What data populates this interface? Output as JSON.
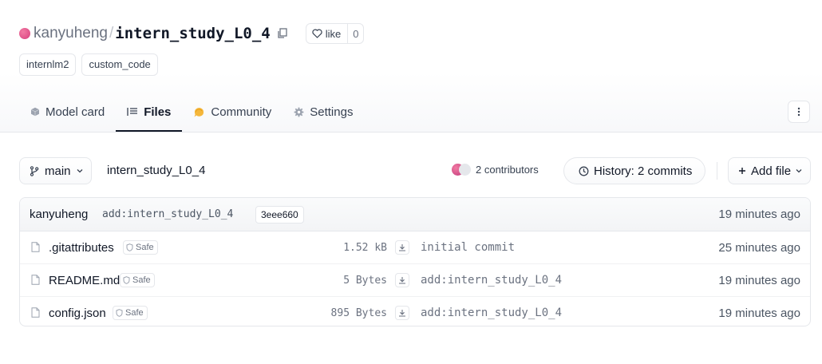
{
  "header": {
    "owner": "kanyuheng",
    "separator": "/",
    "repo_name": "intern_study_L0_4",
    "like_label": "like",
    "like_count": "0"
  },
  "tags": [
    "internlm2",
    "custom_code"
  ],
  "tabs": [
    {
      "label": "Model card",
      "icon": "cube-icon",
      "active": false
    },
    {
      "label": "Files",
      "icon": "files-icon",
      "active": true
    },
    {
      "label": "Community",
      "icon": "community-icon",
      "active": false
    },
    {
      "label": "Settings",
      "icon": "gear-icon",
      "active": false
    }
  ],
  "toolbar": {
    "branch": "main",
    "path": "intern_study_L0_4",
    "contributors": "2 contributors",
    "history": "History: 2 commits",
    "add_file": "Add file"
  },
  "last_commit": {
    "author": "kanyuheng",
    "message": "add:intern_study_L0_4",
    "hash": "3eee660",
    "time": "19 minutes ago"
  },
  "files": [
    {
      "name": ".gitattributes",
      "badge": "Safe",
      "size": "1.52 kB",
      "message": "initial commit",
      "time": "25 minutes ago"
    },
    {
      "name": "README.md",
      "badge": "Safe",
      "size": "5 Bytes",
      "message": "add:intern_study_L0_4",
      "time": "19 minutes ago"
    },
    {
      "name": "config.json",
      "badge": "Safe",
      "size": "895 Bytes",
      "message": "add:intern_study_L0_4",
      "time": "19 minutes ago"
    }
  ],
  "colors": {
    "accent": "#d8407e",
    "community": "#f5b73b"
  }
}
